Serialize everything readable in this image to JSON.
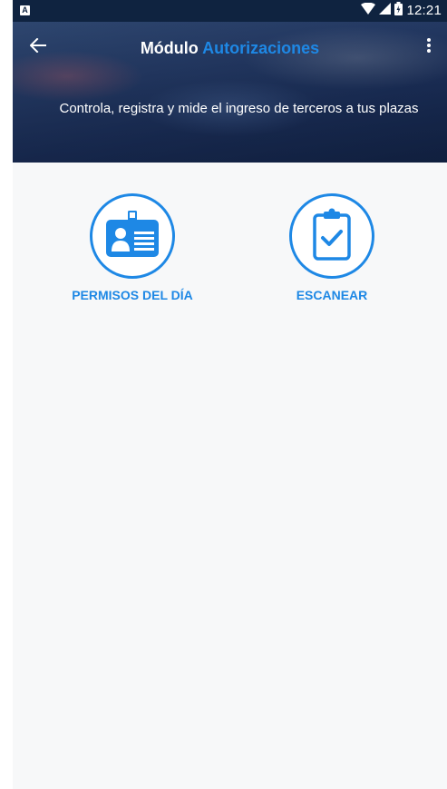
{
  "status_bar": {
    "time": "12:21",
    "app_icon": "A",
    "icons": [
      "wifi-icon",
      "signal-icon",
      "battery-icon"
    ]
  },
  "app_bar": {
    "title_main": "Módulo",
    "title_accent": "Autorizaciones",
    "back_icon": "arrow-back-icon",
    "menu_icon": "more-vert-icon"
  },
  "header": {
    "subtitle": "Controla, registra y mide el ingreso de terceros a tus plazas"
  },
  "options": [
    {
      "label": "PERMISOS DEL DÍA",
      "icon": "id-card-icon"
    },
    {
      "label": "ESCANEAR",
      "icon": "clipboard-check-icon"
    }
  ],
  "colors": {
    "accent": "#1e88e5",
    "status_bar": "#0f2340",
    "background": "#f7f8f9"
  }
}
